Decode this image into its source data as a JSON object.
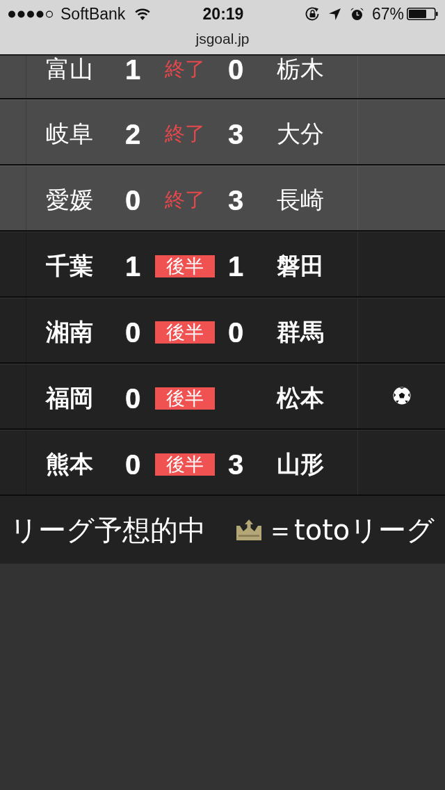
{
  "status_bar": {
    "carrier": "SoftBank",
    "time": "20:19",
    "battery": "67%"
  },
  "address_bar": {
    "url": "jsgoal.jp"
  },
  "matches": [
    {
      "kind": "finished",
      "home": "富山",
      "home_score": "1",
      "status": "終了",
      "away_score": "0",
      "away": "栃木",
      "goal": false
    },
    {
      "kind": "finished",
      "home": "岐阜",
      "home_score": "2",
      "status": "終了",
      "away_score": "3",
      "away": "大分",
      "goal": false
    },
    {
      "kind": "finished",
      "home": "愛媛",
      "home_score": "0",
      "status": "終了",
      "away_score": "3",
      "away": "長崎",
      "goal": false
    },
    {
      "kind": "live",
      "home": "千葉",
      "home_score": "1",
      "status": "後半",
      "away_score": "1",
      "away": "磐田",
      "goal": false
    },
    {
      "kind": "live",
      "home": "湘南",
      "home_score": "0",
      "status": "後半",
      "away_score": "0",
      "away": "群馬",
      "goal": false
    },
    {
      "kind": "live",
      "home": "福岡",
      "home_score": "0",
      "status": "後半",
      "away": "松本",
      "goal": true
    },
    {
      "kind": "live",
      "home": "熊本",
      "home_score": "0",
      "status": "後半",
      "away_score": "3",
      "away": "山形",
      "goal": false
    }
  ],
  "legend": [
    {
      "kind": "plain",
      "text": "リーグ予想的中"
    },
    {
      "kind": "crown",
      "text": "＝totoリーグ"
    }
  ]
}
